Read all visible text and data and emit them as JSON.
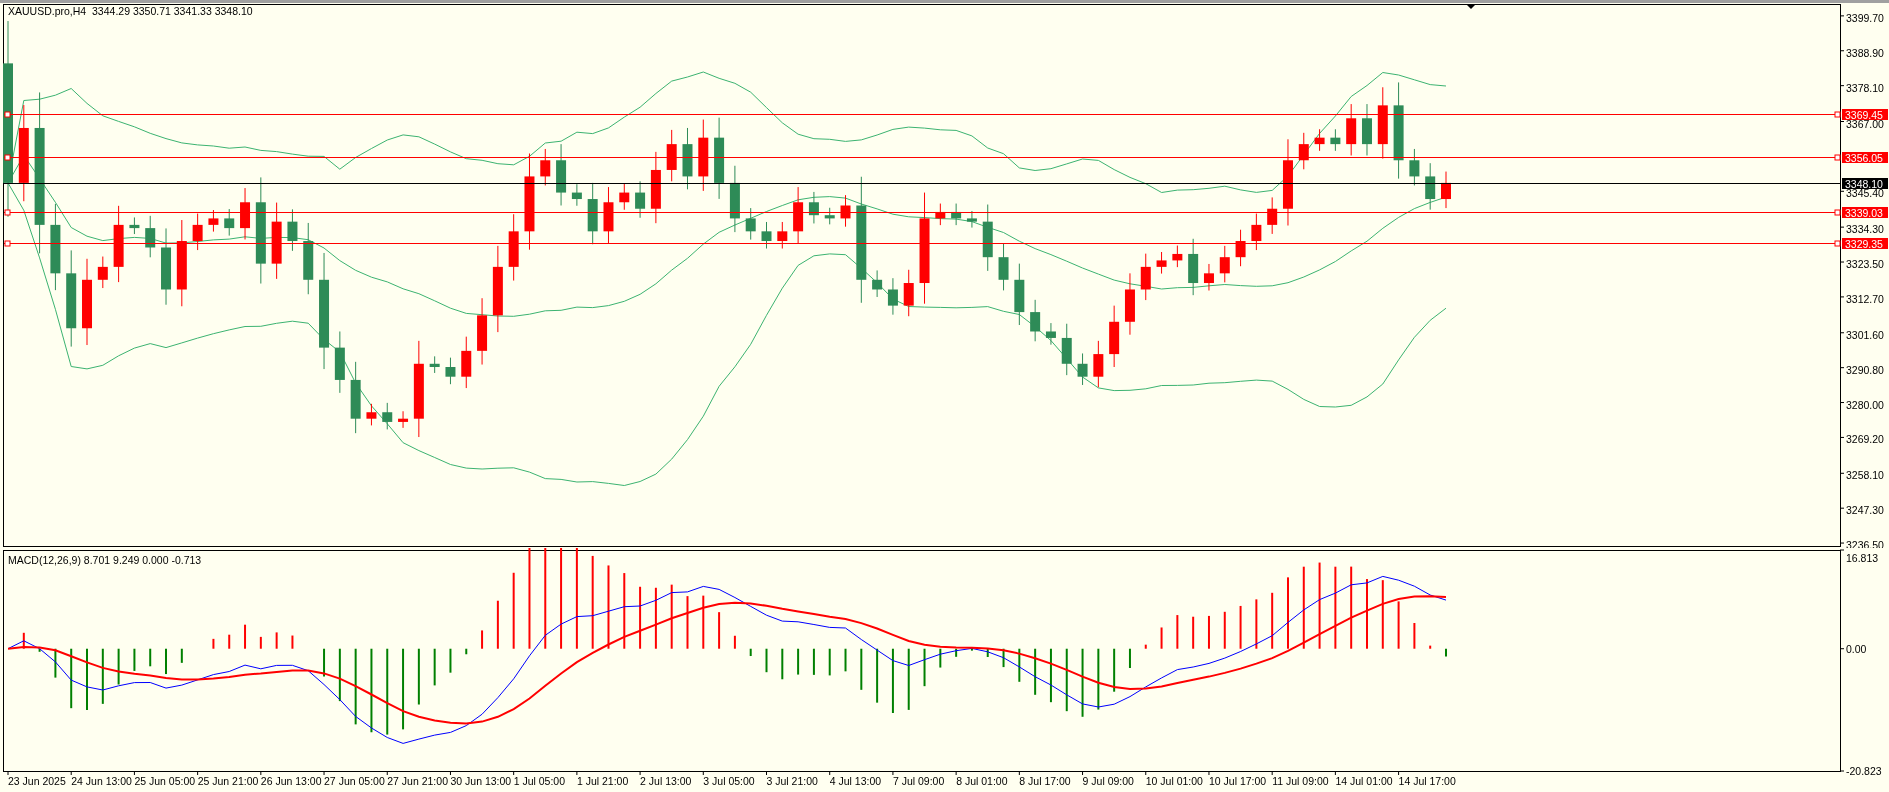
{
  "chart": {
    "title": "XAUUSD.pro,H4  3344.29 3350.71 3341.33 3348.10",
    "price_axis": [
      "3399.70",
      "3388.90",
      "3378.10",
      "3367.00",
      "3345.40",
      "3334.30",
      "3323.50",
      "3312.70",
      "3301.60",
      "3290.80",
      "3280.00",
      "3269.20",
      "3258.10",
      "3247.30",
      "3236.50"
    ],
    "levels": [
      {
        "kind": "level",
        "label": "3369.45",
        "color": "#ff0000"
      },
      {
        "kind": "level",
        "label": "3356.05",
        "color": "#ff0000"
      },
      {
        "kind": "price",
        "label": "3348.10",
        "color": "#000000"
      },
      {
        "kind": "level",
        "label": "3339.03",
        "color": "#ff0000"
      },
      {
        "kind": "level",
        "label": "3329.35",
        "color": "#ff0000"
      }
    ]
  },
  "indicator": {
    "title": "MACD(12,26,9) 8.701 9.249 0.000 -0.713",
    "axis": [
      "16.813",
      "0.00",
      "-20.823"
    ]
  },
  "time_axis": [
    "23 Jun 2025",
    "24 Jun 13:00",
    "25 Jun 05:00",
    "25 Jun 21:00",
    "26 Jun 13:00",
    "27 Jun 05:00",
    "27 Jun 21:00",
    "30 Jun 13:00",
    "1 Jul 05:00",
    "1 Jul 21:00",
    "2 Jul 13:00",
    "3 Jul 05:00",
    "3 Jul 21:00",
    "4 Jul 13:00",
    "7 Jul 09:00",
    "8 Jul 01:00",
    "8 Jul 17:00",
    "9 Jul 09:00",
    "10 Jul 01:00",
    "10 Jul 17:00",
    "11 Jul 09:00",
    "14 Jul 01:00",
    "14 Jul 17:00"
  ]
}
